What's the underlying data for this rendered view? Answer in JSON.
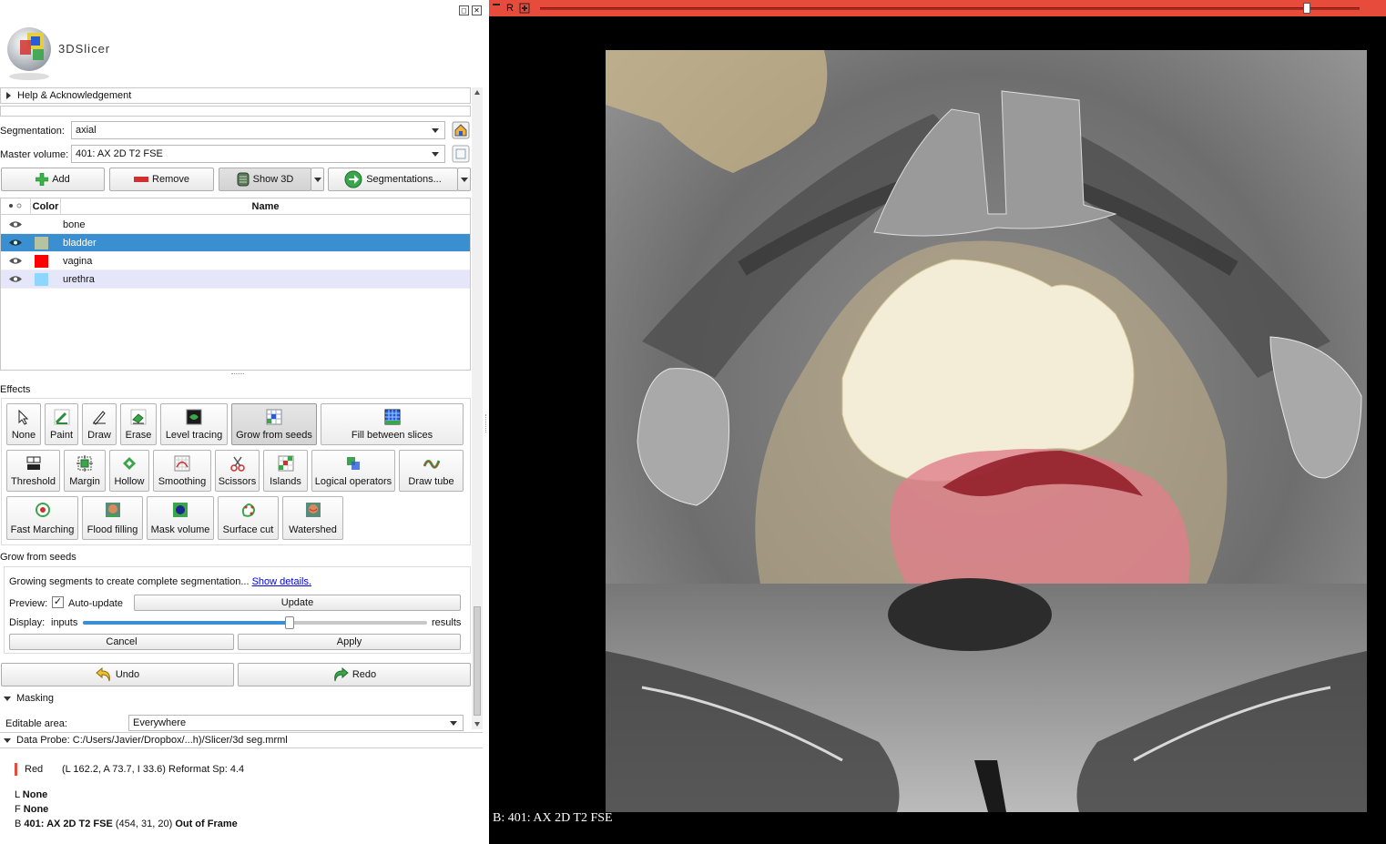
{
  "app": {
    "logo_text": "3DSlicer"
  },
  "window_buttons": [
    "◻",
    "✕"
  ],
  "help": {
    "label": "Help & Acknowledgement"
  },
  "segmentation": {
    "label": "Segmentation:",
    "value": "axial"
  },
  "master_volume": {
    "label": "Master volume:",
    "value": "401: AX 2D T2 FSE"
  },
  "toolbar": {
    "add": "Add",
    "remove": "Remove",
    "show3d": "Show 3D",
    "segmentations": "Segmentations..."
  },
  "table": {
    "headers": {
      "color": "Color",
      "name": "Name"
    },
    "rows": [
      {
        "name": "bone",
        "color": "#ffffff"
      },
      {
        "name": "bladder",
        "color": "#b5c3a3"
      },
      {
        "name": "vagina",
        "color": "#ff0000"
      },
      {
        "name": "urethra",
        "color": "#8cd6ff"
      }
    ]
  },
  "effects": {
    "title": "Effects",
    "items": [
      "None",
      "Paint",
      "Draw",
      "Erase",
      "Level tracing",
      "Grow from seeds",
      "Fill between slices",
      "Threshold",
      "Margin",
      "Hollow",
      "Smoothing",
      "Scissors",
      "Islands",
      "Logical operators",
      "Draw tube",
      "Fast Marching",
      "Flood filling",
      "Mask volume",
      "Surface cut",
      "Watershed"
    ]
  },
  "grow": {
    "title": "Grow from seeds",
    "desc": "Growing segments to create complete segmentation...",
    "show_details": "Show details.",
    "preview_label": "Preview:",
    "auto_update": "Auto-update",
    "update": "Update",
    "display_label": "Display:",
    "inputs": "inputs",
    "results": "results",
    "display_value": 0.6,
    "cancel": "Cancel",
    "apply": "Apply"
  },
  "undo": "Undo",
  "redo": "Redo",
  "masking": {
    "title": "Masking",
    "editable_label": "Editable area:",
    "editable_value": "Everywhere"
  },
  "data_probe": {
    "label": "Data Probe: C:/Users/Javier/Dropbox/...h)/Slicer/3d seg.mrml",
    "view_name": "Red",
    "coords": "(L 162.2, A 73.7, I 33.6)",
    "reformat": "Reformat Sp: 4.4",
    "l_label": "L",
    "l_value": "None",
    "f_label": "F",
    "f_value": "None",
    "b_label": "B",
    "b_volume": "401: AX 2D T2 FSE",
    "b_ijk": "(454,  31,  20)",
    "b_status": "Out of Frame"
  },
  "viewer": {
    "bar_letter": "R",
    "slice_label": "B: 401: AX 2D T2 FSE"
  },
  "colors": {
    "accent": "#3a8fd0",
    "red_view": "#e64b3c"
  }
}
